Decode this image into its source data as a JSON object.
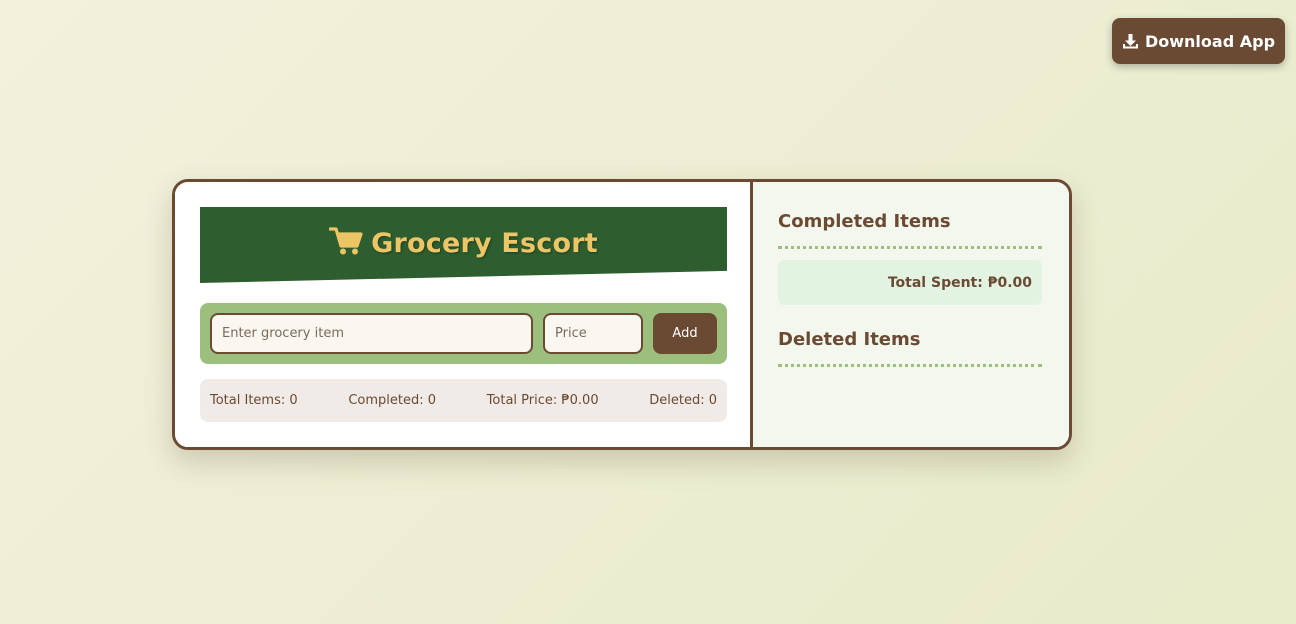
{
  "toolbar": {
    "download_label": "Download App",
    "download_icon": "download-icon"
  },
  "app": {
    "title": "Grocery Escort",
    "title_icon": "shopping-cart-icon"
  },
  "form": {
    "item_placeholder": "Enter grocery item",
    "item_value": "",
    "price_placeholder": "Price",
    "price_value": "",
    "add_label": "Add"
  },
  "stats": {
    "total_items": "Total Items: 0",
    "completed": "Completed: 0",
    "total_price": "Total Price: ₱0.00",
    "deleted": "Deleted: 0"
  },
  "sidebar": {
    "completed_title": "Completed Items",
    "total_spent": "Total Spent: ₱0.00",
    "deleted_title": "Deleted Items"
  },
  "colors": {
    "brown": "#6b4a33",
    "dark_green": "#2e5e2f",
    "gold": "#ebc566",
    "sage": "#9dbf7e",
    "mint": "#e2f3e2"
  }
}
